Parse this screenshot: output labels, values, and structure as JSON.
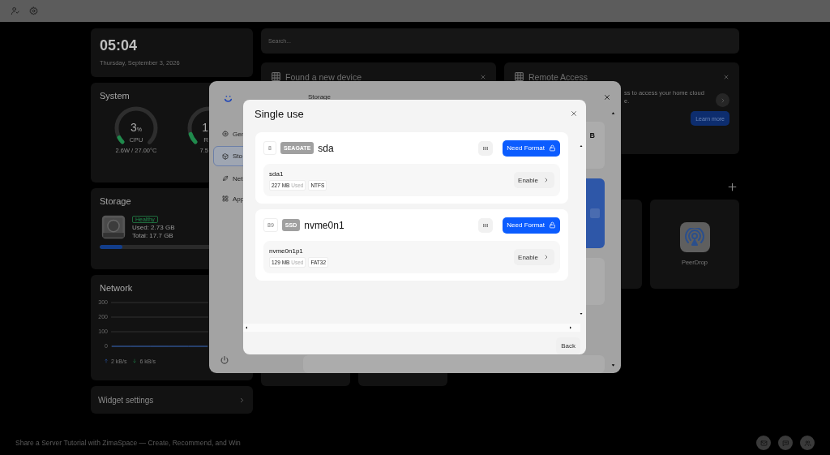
{
  "clock": {
    "time": "05:04",
    "date": "Thursday, September 3, 2026"
  },
  "system": {
    "title": "System",
    "gauges": [
      {
        "value": "3",
        "unit": "%",
        "label": "CPU",
        "detail": "2.6W / 27.00°C",
        "level": 0.06
      },
      {
        "value": "1",
        "label": "R",
        "detail": "7.5",
        "level": 0.1
      }
    ]
  },
  "storage": {
    "title": "Storage",
    "status": "Healthy",
    "used": "Used: 2.73 GB",
    "total": "Total: 17.7 GB",
    "level": 0.16
  },
  "network": {
    "title": "Network",
    "chart_data": {
      "type": "line",
      "ylim": [
        0,
        300
      ],
      "yticks": [
        0,
        100,
        200,
        300
      ],
      "series": [
        {
          "color": "#2d5fb8",
          "values": [
            0,
            0,
            0,
            0,
            0,
            0
          ]
        }
      ]
    },
    "upload": "2 kB/s",
    "download": "6 kB/s"
  },
  "widget_settings": {
    "label": "Widget settings"
  },
  "search": {
    "placeholder": "Search..."
  },
  "notices": [
    {
      "title": "Found a new device"
    },
    {
      "title": "Remote Access",
      "text": "ss to access your home cloud",
      "text_2": "e.",
      "button": "Learn more"
    }
  ],
  "apps": [
    {
      "name": "PeerDrop"
    }
  ],
  "settings_window": {
    "title": "Storage",
    "pane_text": "B",
    "sidebar": [
      {
        "label": "Gen",
        "kind": "general",
        "selected": false
      },
      {
        "label": "Sto",
        "kind": "storage",
        "selected": true
      },
      {
        "label": "Net",
        "kind": "network",
        "selected": false
      },
      {
        "label": "App",
        "kind": "apps",
        "selected": false
      }
    ]
  },
  "dialog": {
    "title": "Single use",
    "button": "Back",
    "disks": [
      {
        "index": "8",
        "brand": "SEAGATE",
        "name": "sda",
        "action": "Need Format",
        "partitions": [
          {
            "name": "sda1",
            "size": "227 MB",
            "size_label": "Used",
            "fs": "NTFS",
            "button": "Enable"
          }
        ]
      },
      {
        "index": "89",
        "brand": "SSD",
        "name": "nvme0n1",
        "action": "Need Format",
        "partitions": [
          {
            "name": "nvme0n1p1",
            "size": "129 MB",
            "size_label": "Used",
            "fs": "FAT32",
            "button": "Enable"
          }
        ]
      }
    ]
  },
  "footer": {
    "text": "Share a Server Tutorial with ZimaSpace — Create, Recommend, and Win"
  }
}
